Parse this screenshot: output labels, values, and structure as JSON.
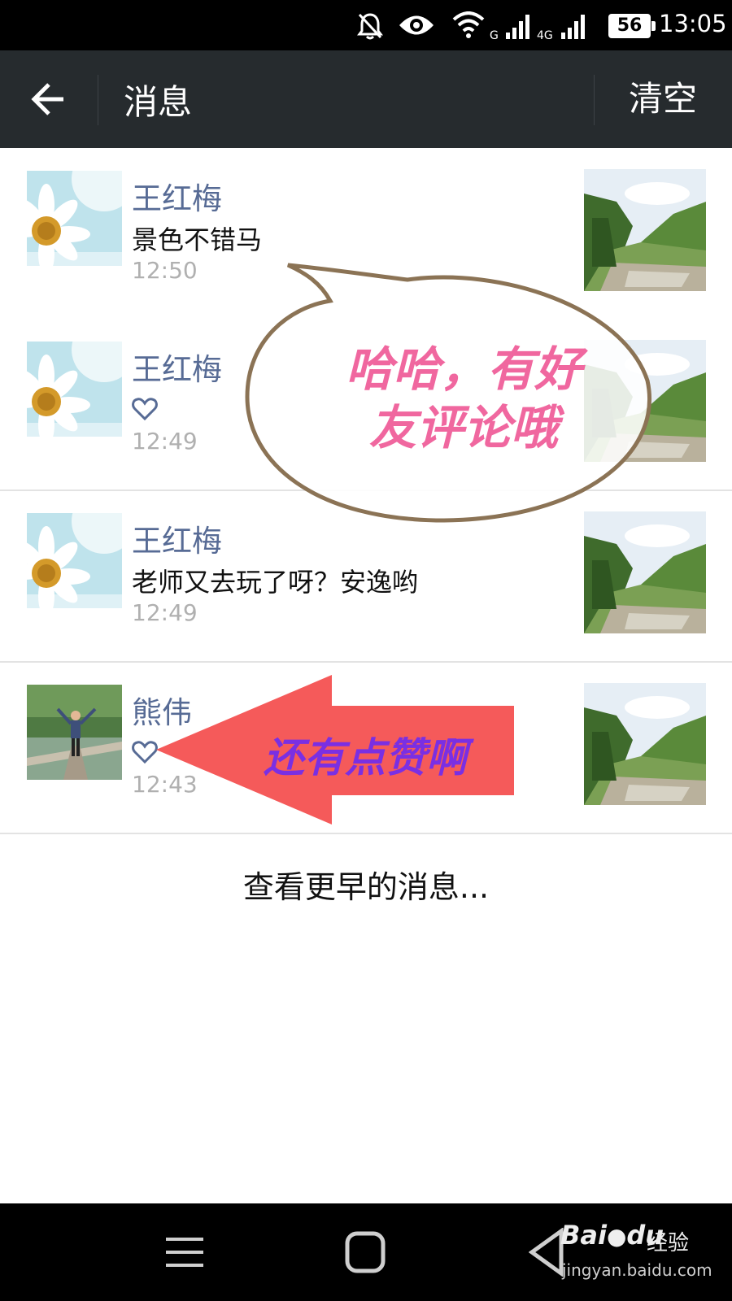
{
  "status_bar": {
    "battery": "56",
    "time": "13:05",
    "icons": [
      "mute-bell-icon",
      "eye-icon",
      "wifi-icon",
      "signal-icon",
      "4g-signal-icon",
      "battery-icon"
    ]
  },
  "header": {
    "title": "消息",
    "clear_label": "清空",
    "back_icon": "back-arrow-icon"
  },
  "messages": [
    {
      "sender": "王红梅",
      "text": "景色不错马",
      "time": "12:50",
      "type": "comment",
      "avatar": "daisy-avatar"
    },
    {
      "sender": "王红梅",
      "text": "",
      "time": "12:49",
      "type": "like",
      "avatar": "daisy-avatar"
    },
    {
      "sender": "王红梅",
      "text": "老师又去玩了呀？安逸哟",
      "time": "12:49",
      "type": "comment",
      "avatar": "daisy-avatar"
    },
    {
      "sender": "熊伟",
      "text": "",
      "time": "12:43",
      "type": "like",
      "avatar": "person-avatar"
    }
  ],
  "load_more": "查看更早的消息...",
  "annotations": {
    "bubble_line1": "哈哈，有好",
    "bubble_line2": "友评论哦",
    "arrow_text": "还有点赞啊"
  },
  "colors": {
    "header_bg": "#262b2e",
    "sender_name": "#576b95",
    "time_gray": "#b0b0b0",
    "bubble_border": "#8b7355",
    "bubble_text": "#f0679f",
    "arrow_fill": "#f55a5a",
    "arrow_text": "#7a2fe3"
  },
  "watermark": {
    "brand": "Bai",
    "brand_suffix": "du",
    "cn": "经验",
    "url": "jingyan.baidu.com"
  }
}
